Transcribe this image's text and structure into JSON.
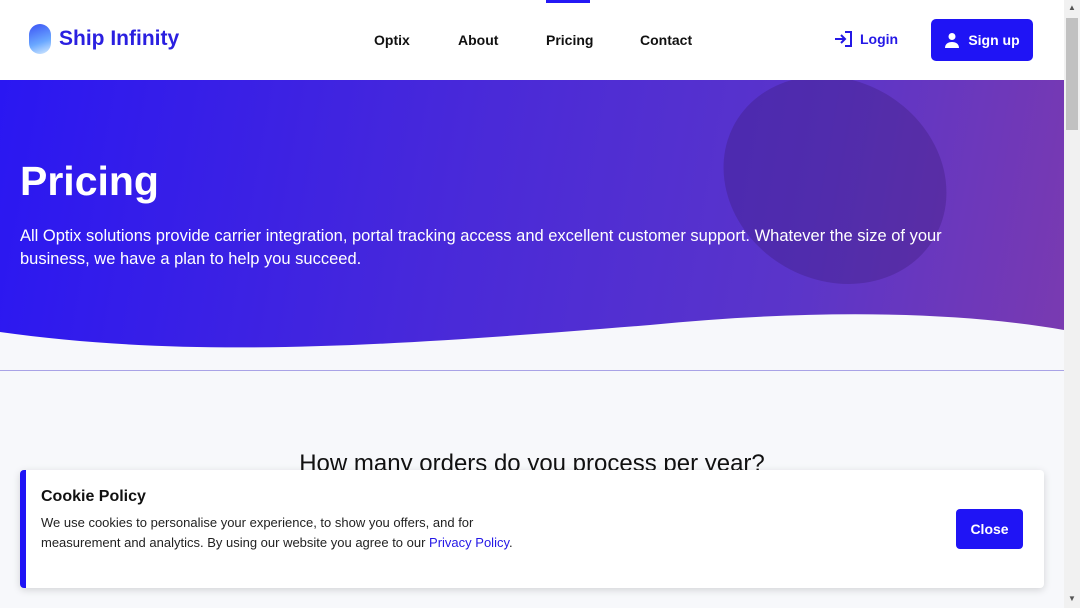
{
  "header": {
    "brand": "Ship Infinity",
    "nav": [
      "Optix",
      "About",
      "Pricing",
      "Contact"
    ],
    "active_nav": "Pricing",
    "login": "Login",
    "signup": "Sign up"
  },
  "hero": {
    "title": "Pricing",
    "description": "All Optix solutions provide carrier integration, portal tracking access and excellent customer support. Whatever the size of your business, we have a plan to help you succeed."
  },
  "main": {
    "question": "How many orders do you process per year?"
  },
  "cookie": {
    "title": "Cookie Policy",
    "text": "We use cookies to personalise your experience, to show you offers, and for measurement and analytics. By using our website you agree to our ",
    "link": "Privacy Policy",
    "end": ".",
    "close": "Close"
  },
  "colors": {
    "brand": "#1f14f5"
  }
}
